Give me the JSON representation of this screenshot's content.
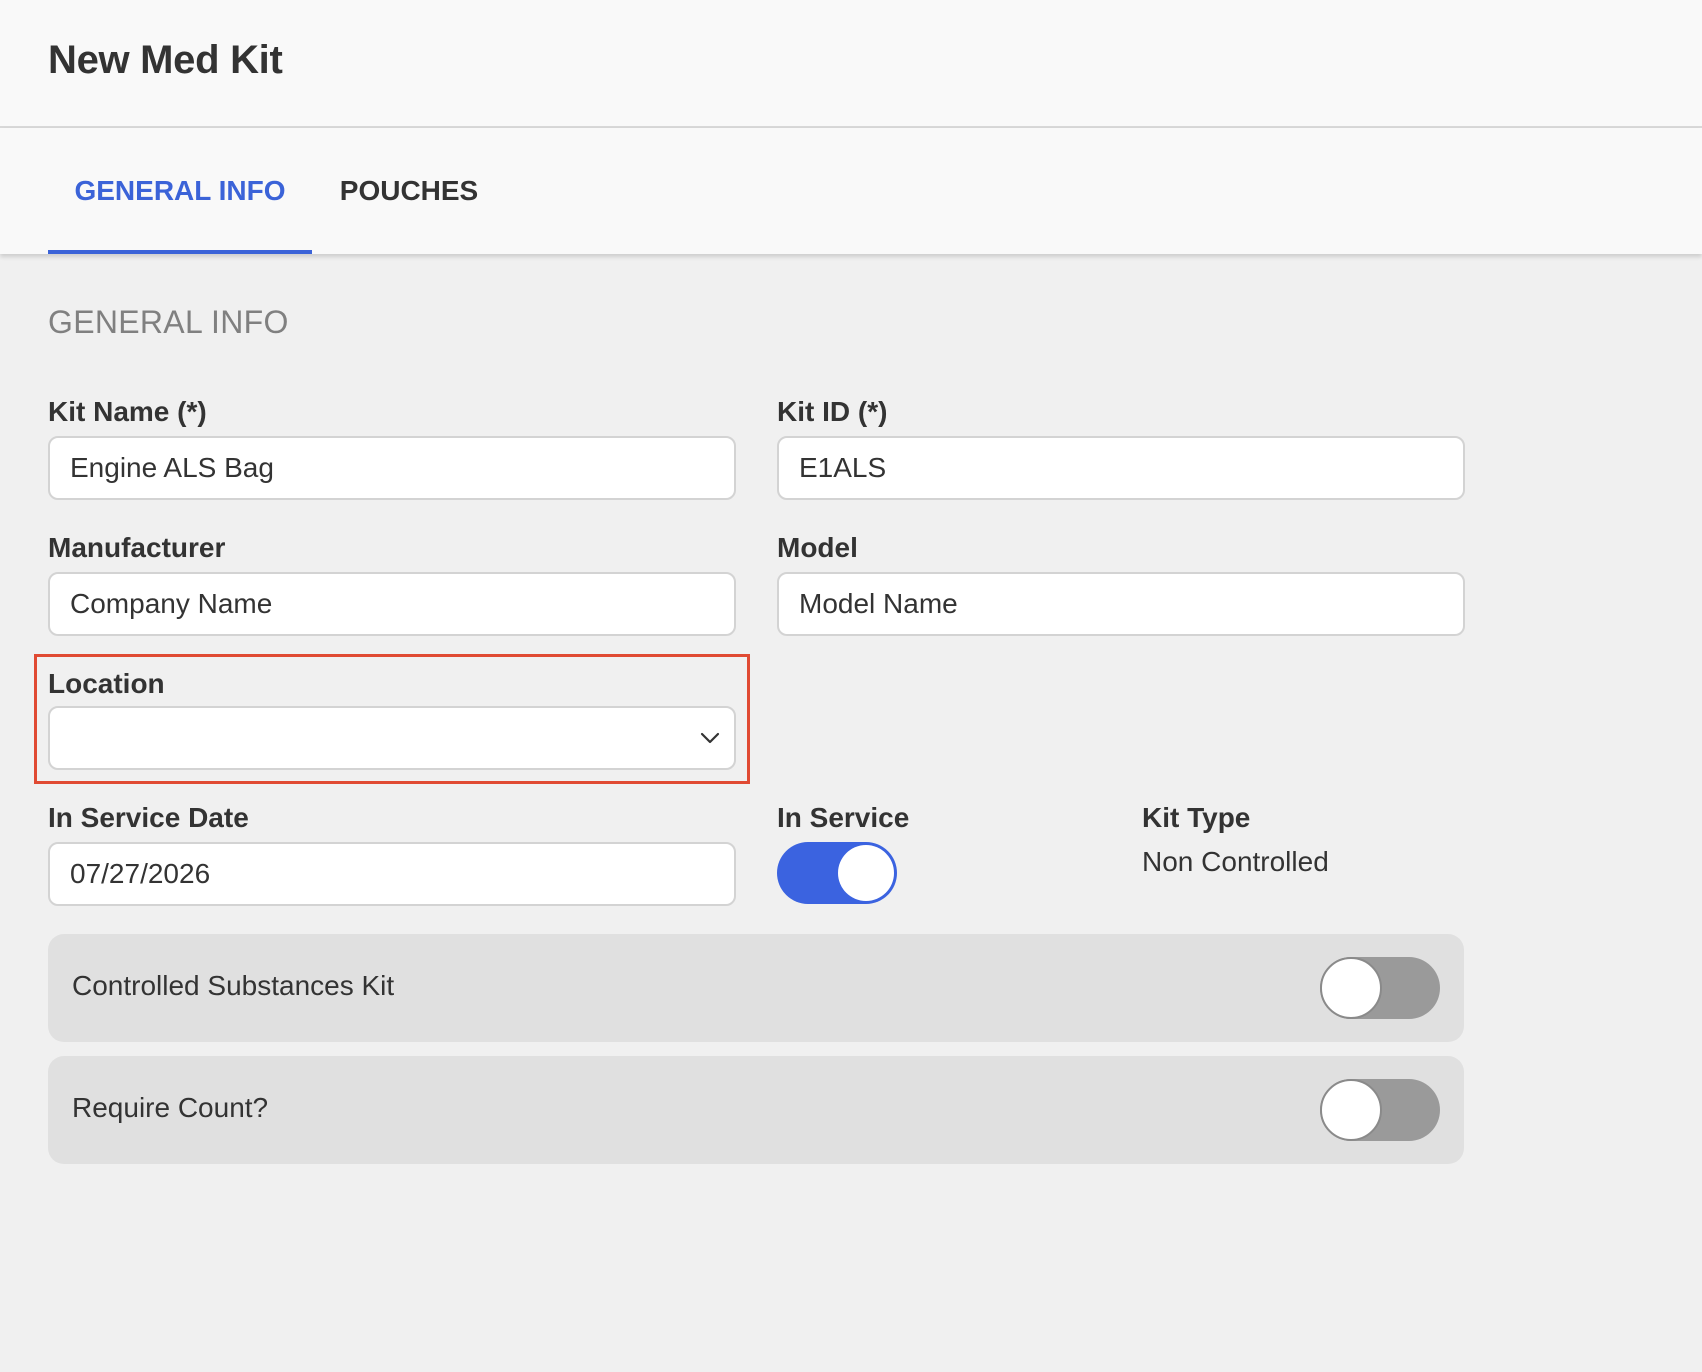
{
  "header": {
    "title": "New Med Kit"
  },
  "tabs": [
    {
      "label": "GENERAL INFO",
      "active": true
    },
    {
      "label": "POUCHES",
      "active": false
    }
  ],
  "section": {
    "title": "GENERAL INFO"
  },
  "fields": {
    "kit_name": {
      "label": "Kit Name (*)",
      "value": "Engine ALS Bag"
    },
    "kit_id": {
      "label": "Kit ID (*)",
      "value": "E1ALS"
    },
    "manufacturer": {
      "label": "Manufacturer",
      "value": "Company Name"
    },
    "model": {
      "label": "Model",
      "value": "Model Name"
    },
    "location": {
      "label": "Location",
      "value": "",
      "icon": "chevron-down-icon"
    },
    "in_service_date": {
      "label": "In Service Date",
      "value": "07/27/2026"
    },
    "in_service": {
      "label": "In Service",
      "on": true
    },
    "kit_type": {
      "label": "Kit Type",
      "value": "Non Controlled"
    }
  },
  "switches": [
    {
      "label": "Controlled Substances Kit",
      "on": false
    },
    {
      "label": "Require Count?",
      "on": false
    }
  ],
  "colors": {
    "accent": "#3b63d8",
    "highlight": "#e04a33",
    "toggle_off": "#9a9a9a"
  }
}
